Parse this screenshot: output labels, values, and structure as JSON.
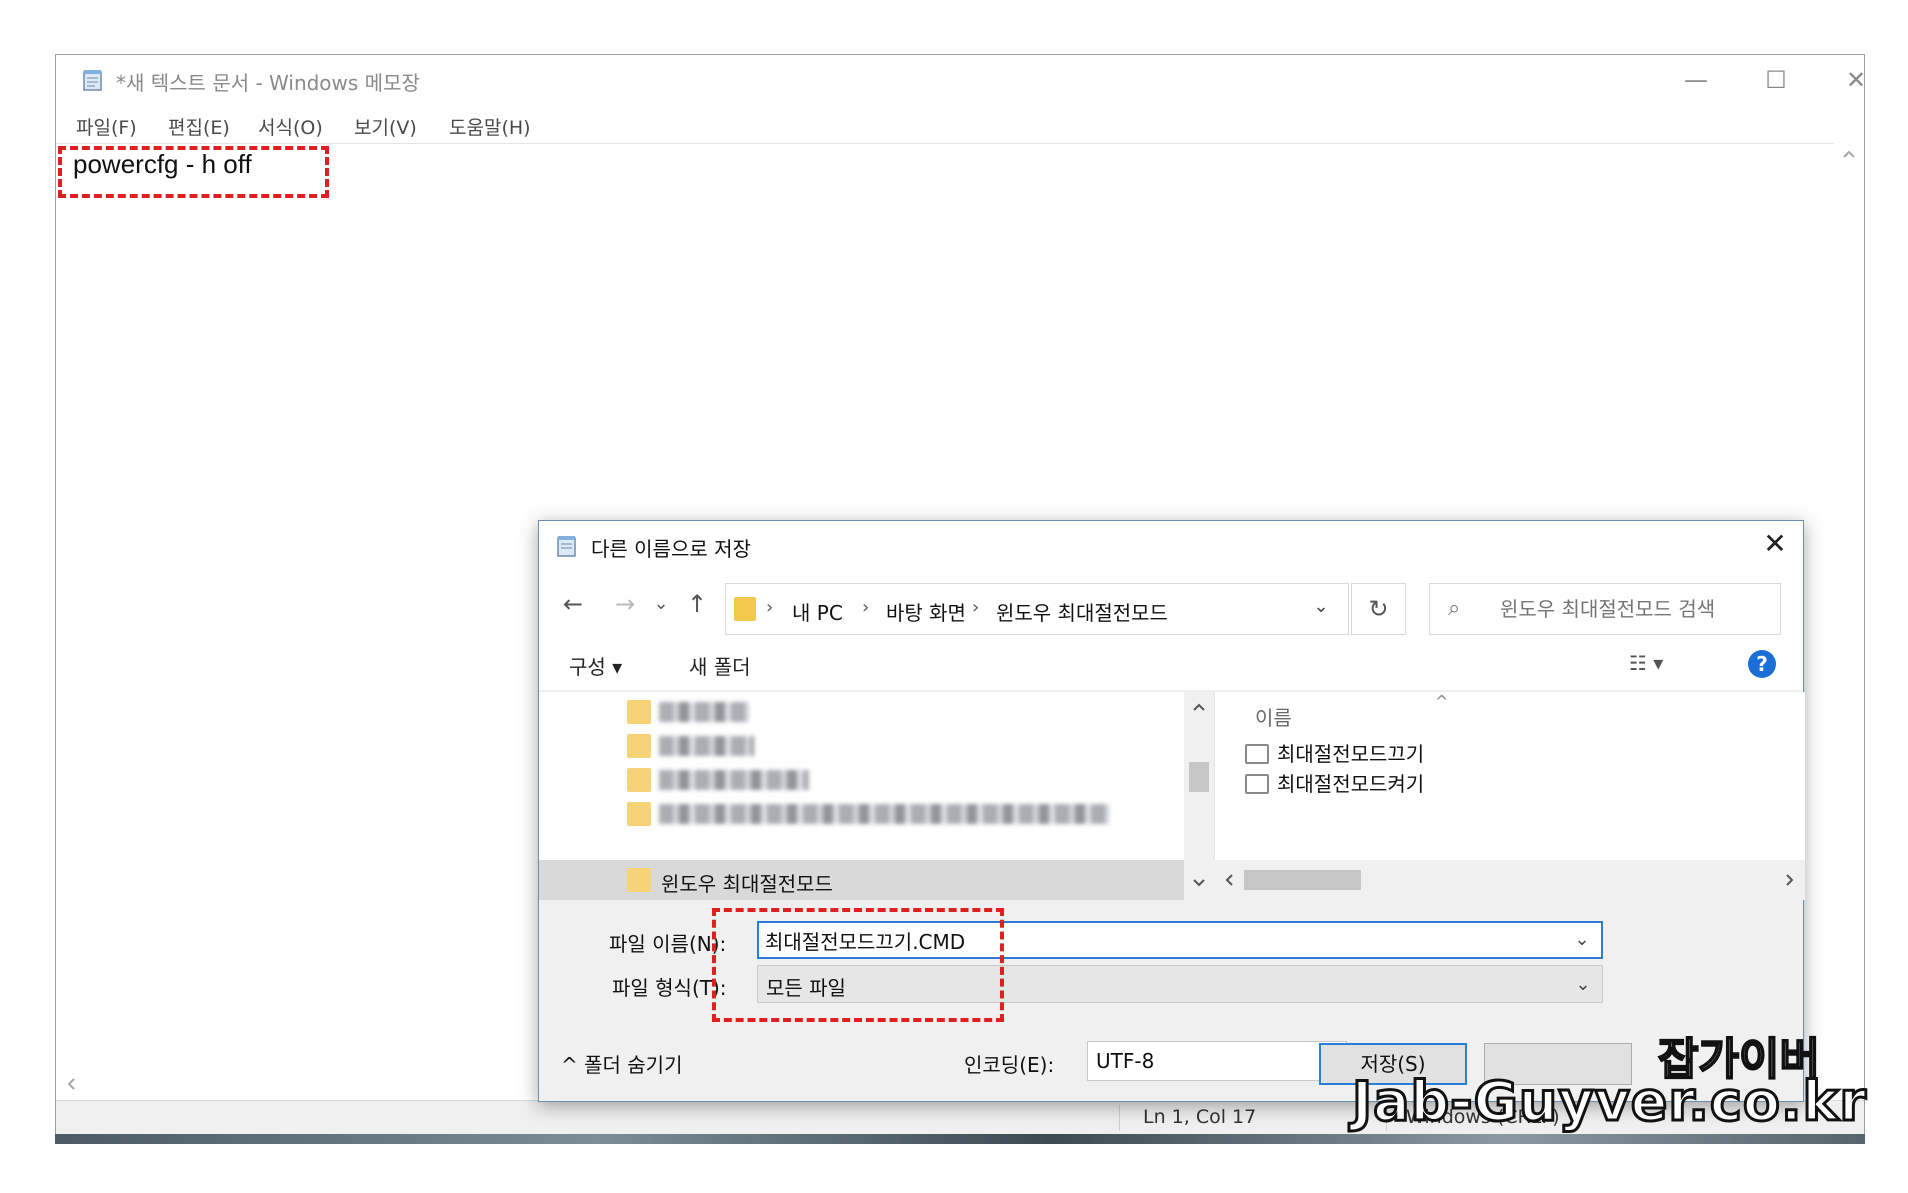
{
  "notepad": {
    "title": "*새 텍스트 문서 - Windows 메모장",
    "window_controls": {
      "minimize": "—",
      "maximize": "☐",
      "close": "✕"
    },
    "menu": [
      "파일(F)",
      "편집(E)",
      "서식(O)",
      "보기(V)",
      "도움말(H)"
    ],
    "content": "powercfg - h off",
    "status": {
      "position": "Ln 1, Col 17",
      "line_ending": "Windows (CRLF)"
    }
  },
  "dialog": {
    "title": "다른 이름으로 저장",
    "close": "✕",
    "nav": {
      "back": "←",
      "forward": "→",
      "recent": "⌄",
      "up": "↑",
      "refresh": "↻"
    },
    "breadcrumb": [
      "내 PC",
      "바탕 화면",
      "윈도우 최대절전모드"
    ],
    "search_placeholder": "윈도우 최대절전모드 검색",
    "toolbar": {
      "organize": "구성 ▾",
      "new_folder": "새 폴더",
      "view": "☷ ▾",
      "help": "?"
    },
    "tree": {
      "selected_folder": "윈도우 최대절전모드"
    },
    "list": {
      "column_header": "이름",
      "sort_indicator": "^",
      "files": [
        "최대절전모드끄기",
        "최대절전모드켜기"
      ]
    },
    "filename_label": "파일 이름(N):",
    "filename_value": "최대절전모드끄기.CMD",
    "filetype_label": "파일 형식(T):",
    "filetype_value": "모든 파일",
    "hide_folders": "^ 폴더 숨기기",
    "encoding_label": "인코딩(E):",
    "encoding_value": "UTF-8",
    "save_button": "저장(S)"
  },
  "watermark": {
    "korean": "잡가이버",
    "site": "Jab-Guyver.co.kr"
  }
}
